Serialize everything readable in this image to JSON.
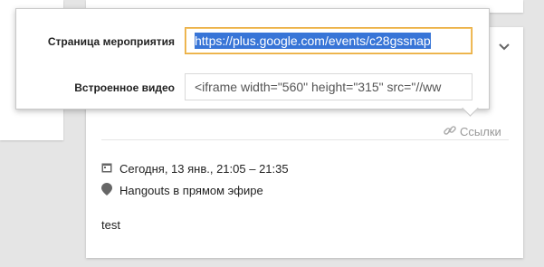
{
  "popup": {
    "event_page_label": "Страница мероприятия",
    "event_page_value": "https://plus.google.com/events/c28gssnap",
    "embed_video_label": "Встроенное видео",
    "embed_video_value": "<iframe width=\"560\" height=\"315\" src=\"//ww"
  },
  "card": {
    "links_label": "Ссылки",
    "date": "Сегодня, 13 янв., 21:05 – 21:35",
    "place": "Hangouts в прямом эфире",
    "description": "test",
    "chevron_icon": "chevron-down-icon",
    "link_icon": "link-icon",
    "calendar_icon": "calendar-icon",
    "location_icon": "location-pin-icon"
  },
  "colors": {
    "focus_border": "#e8a93a",
    "selection": "#3875d7",
    "muted_text": "#999999"
  }
}
